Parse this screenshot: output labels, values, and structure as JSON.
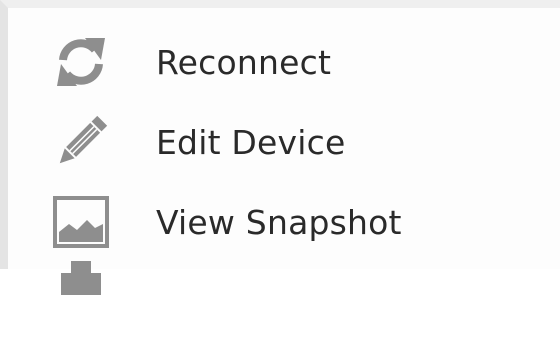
{
  "menu": {
    "items": [
      {
        "label": "Reconnect",
        "icon": "refresh-icon"
      },
      {
        "label": "Edit Device",
        "icon": "pencil-icon"
      },
      {
        "label": "View Snapshot",
        "icon": "image-icon"
      }
    ],
    "partial_item_icon": "printer-icon"
  },
  "colors": {
    "icon": "#8e8e8e",
    "text": "#2a2a2a",
    "background": "#fdfdfd",
    "divider": "#e4e4e4"
  }
}
